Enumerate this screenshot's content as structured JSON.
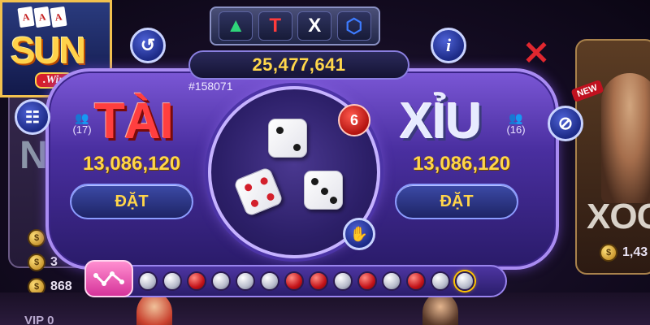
{
  "logo": {
    "text": "SUN",
    "sub": ".Win",
    "cards": [
      "A",
      "A",
      "A"
    ]
  },
  "tabs": [
    {
      "symbol": "▲",
      "color": "#2fd57a",
      "name": "triangle"
    },
    {
      "symbol": "T",
      "color": "#ff3b3b",
      "name": "t-letter"
    },
    {
      "symbol": "X",
      "color": "#ffffff",
      "name": "x-letter"
    },
    {
      "symbol": "⬡",
      "color": "#3d7bff",
      "name": "hexagon"
    }
  ],
  "jackpot": "25,477,641",
  "round_id": "#158071",
  "tai": {
    "title": "TÀI",
    "players": "(17)",
    "amount": "13,086,120",
    "bet_label": "ĐẶT"
  },
  "xiu": {
    "title": "XỈU",
    "players": "(16)",
    "amount": "13,086,120",
    "bet_label": "ĐẶT"
  },
  "dice_total": "6",
  "dice": [
    2,
    4,
    3
  ],
  "history": [
    "xiu",
    "xiu",
    "tai",
    "xiu",
    "xiu",
    "xiu",
    "tai",
    "tai",
    "xiu",
    "tai",
    "xiu",
    "tai",
    "xiu",
    "xiu"
  ],
  "icons": {
    "history_btn": "↺",
    "info_btn": "i",
    "close_btn": "✕",
    "clipboard_btn": "☷",
    "mute_btn": "⊘",
    "hand_btn": "✋"
  },
  "background": {
    "left_label": "N",
    "left_coins": [
      "2",
      "3",
      "868"
    ],
    "right_label": "XOC",
    "right_coin_value": "1,43",
    "new_badge": "NEW",
    "vip_label": "VIP 0"
  },
  "colors": {
    "tai": "#ff3f3f",
    "xiu": "#e7ebff",
    "gold": "#ffd54a",
    "panel": "#4a2fa0"
  }
}
